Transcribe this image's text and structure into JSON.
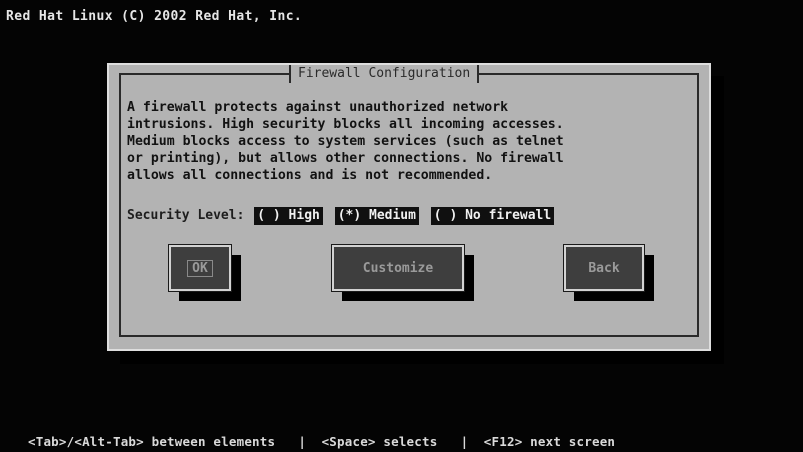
{
  "banner": {
    "text": "Red Hat Linux (C) 2002 Red Hat, Inc."
  },
  "dialog": {
    "title": "Firewall Configuration",
    "description": "A firewall protects against unauthorized network\nintrusions. High security blocks all incoming accesses.\nMedium blocks access to system services (such as telnet\nor printing), but allows other connections. No firewall\nallows all connections and is not recommended.",
    "security_level": {
      "label": "Security Level:",
      "options": [
        {
          "text": "( ) High",
          "selected": false
        },
        {
          "text": "(*) Medium",
          "selected": true
        },
        {
          "text": "( ) No firewall",
          "selected": false
        }
      ]
    },
    "buttons": {
      "ok": "OK",
      "customize": "Customize",
      "back": "Back"
    }
  },
  "help_line": "<Tab>/<Alt-Tab> between elements   |  <Space> selects   |  <F12> next screen",
  "colors": {
    "screen_background": "#040404",
    "dialog_background": "#b3b3b3",
    "button_background": "#3e3e3e",
    "button_text": "#9a9a9a",
    "radio_background": "#101010"
  }
}
